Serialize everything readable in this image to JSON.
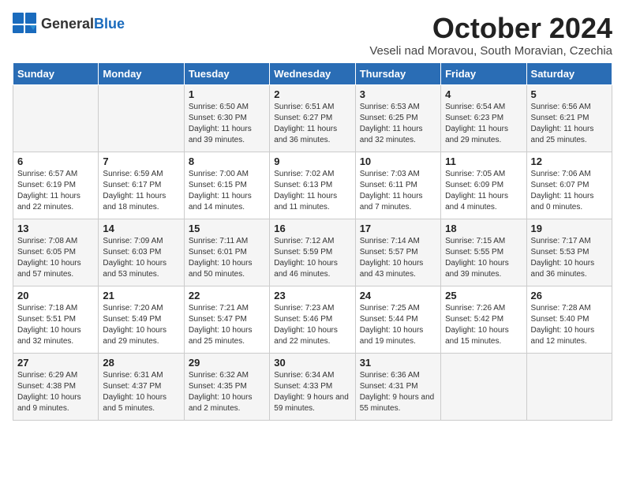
{
  "header": {
    "logo_general": "General",
    "logo_blue": "Blue",
    "month_title": "October 2024",
    "subtitle": "Veseli nad Moravou, South Moravian, Czechia"
  },
  "columns": [
    "Sunday",
    "Monday",
    "Tuesday",
    "Wednesday",
    "Thursday",
    "Friday",
    "Saturday"
  ],
  "weeks": [
    [
      {
        "day": "",
        "info": ""
      },
      {
        "day": "",
        "info": ""
      },
      {
        "day": "1",
        "info": "Sunrise: 6:50 AM\nSunset: 6:30 PM\nDaylight: 11 hours and 39 minutes."
      },
      {
        "day": "2",
        "info": "Sunrise: 6:51 AM\nSunset: 6:27 PM\nDaylight: 11 hours and 36 minutes."
      },
      {
        "day": "3",
        "info": "Sunrise: 6:53 AM\nSunset: 6:25 PM\nDaylight: 11 hours and 32 minutes."
      },
      {
        "day": "4",
        "info": "Sunrise: 6:54 AM\nSunset: 6:23 PM\nDaylight: 11 hours and 29 minutes."
      },
      {
        "day": "5",
        "info": "Sunrise: 6:56 AM\nSunset: 6:21 PM\nDaylight: 11 hours and 25 minutes."
      }
    ],
    [
      {
        "day": "6",
        "info": "Sunrise: 6:57 AM\nSunset: 6:19 PM\nDaylight: 11 hours and 22 minutes."
      },
      {
        "day": "7",
        "info": "Sunrise: 6:59 AM\nSunset: 6:17 PM\nDaylight: 11 hours and 18 minutes."
      },
      {
        "day": "8",
        "info": "Sunrise: 7:00 AM\nSunset: 6:15 PM\nDaylight: 11 hours and 14 minutes."
      },
      {
        "day": "9",
        "info": "Sunrise: 7:02 AM\nSunset: 6:13 PM\nDaylight: 11 hours and 11 minutes."
      },
      {
        "day": "10",
        "info": "Sunrise: 7:03 AM\nSunset: 6:11 PM\nDaylight: 11 hours and 7 minutes."
      },
      {
        "day": "11",
        "info": "Sunrise: 7:05 AM\nSunset: 6:09 PM\nDaylight: 11 hours and 4 minutes."
      },
      {
        "day": "12",
        "info": "Sunrise: 7:06 AM\nSunset: 6:07 PM\nDaylight: 11 hours and 0 minutes."
      }
    ],
    [
      {
        "day": "13",
        "info": "Sunrise: 7:08 AM\nSunset: 6:05 PM\nDaylight: 10 hours and 57 minutes."
      },
      {
        "day": "14",
        "info": "Sunrise: 7:09 AM\nSunset: 6:03 PM\nDaylight: 10 hours and 53 minutes."
      },
      {
        "day": "15",
        "info": "Sunrise: 7:11 AM\nSunset: 6:01 PM\nDaylight: 10 hours and 50 minutes."
      },
      {
        "day": "16",
        "info": "Sunrise: 7:12 AM\nSunset: 5:59 PM\nDaylight: 10 hours and 46 minutes."
      },
      {
        "day": "17",
        "info": "Sunrise: 7:14 AM\nSunset: 5:57 PM\nDaylight: 10 hours and 43 minutes."
      },
      {
        "day": "18",
        "info": "Sunrise: 7:15 AM\nSunset: 5:55 PM\nDaylight: 10 hours and 39 minutes."
      },
      {
        "day": "19",
        "info": "Sunrise: 7:17 AM\nSunset: 5:53 PM\nDaylight: 10 hours and 36 minutes."
      }
    ],
    [
      {
        "day": "20",
        "info": "Sunrise: 7:18 AM\nSunset: 5:51 PM\nDaylight: 10 hours and 32 minutes."
      },
      {
        "day": "21",
        "info": "Sunrise: 7:20 AM\nSunset: 5:49 PM\nDaylight: 10 hours and 29 minutes."
      },
      {
        "day": "22",
        "info": "Sunrise: 7:21 AM\nSunset: 5:47 PM\nDaylight: 10 hours and 25 minutes."
      },
      {
        "day": "23",
        "info": "Sunrise: 7:23 AM\nSunset: 5:46 PM\nDaylight: 10 hours and 22 minutes."
      },
      {
        "day": "24",
        "info": "Sunrise: 7:25 AM\nSunset: 5:44 PM\nDaylight: 10 hours and 19 minutes."
      },
      {
        "day": "25",
        "info": "Sunrise: 7:26 AM\nSunset: 5:42 PM\nDaylight: 10 hours and 15 minutes."
      },
      {
        "day": "26",
        "info": "Sunrise: 7:28 AM\nSunset: 5:40 PM\nDaylight: 10 hours and 12 minutes."
      }
    ],
    [
      {
        "day": "27",
        "info": "Sunrise: 6:29 AM\nSunset: 4:38 PM\nDaylight: 10 hours and 9 minutes."
      },
      {
        "day": "28",
        "info": "Sunrise: 6:31 AM\nSunset: 4:37 PM\nDaylight: 10 hours and 5 minutes."
      },
      {
        "day": "29",
        "info": "Sunrise: 6:32 AM\nSunset: 4:35 PM\nDaylight: 10 hours and 2 minutes."
      },
      {
        "day": "30",
        "info": "Sunrise: 6:34 AM\nSunset: 4:33 PM\nDaylight: 9 hours and 59 minutes."
      },
      {
        "day": "31",
        "info": "Sunrise: 6:36 AM\nSunset: 4:31 PM\nDaylight: 9 hours and 55 minutes."
      },
      {
        "day": "",
        "info": ""
      },
      {
        "day": "",
        "info": ""
      }
    ]
  ]
}
